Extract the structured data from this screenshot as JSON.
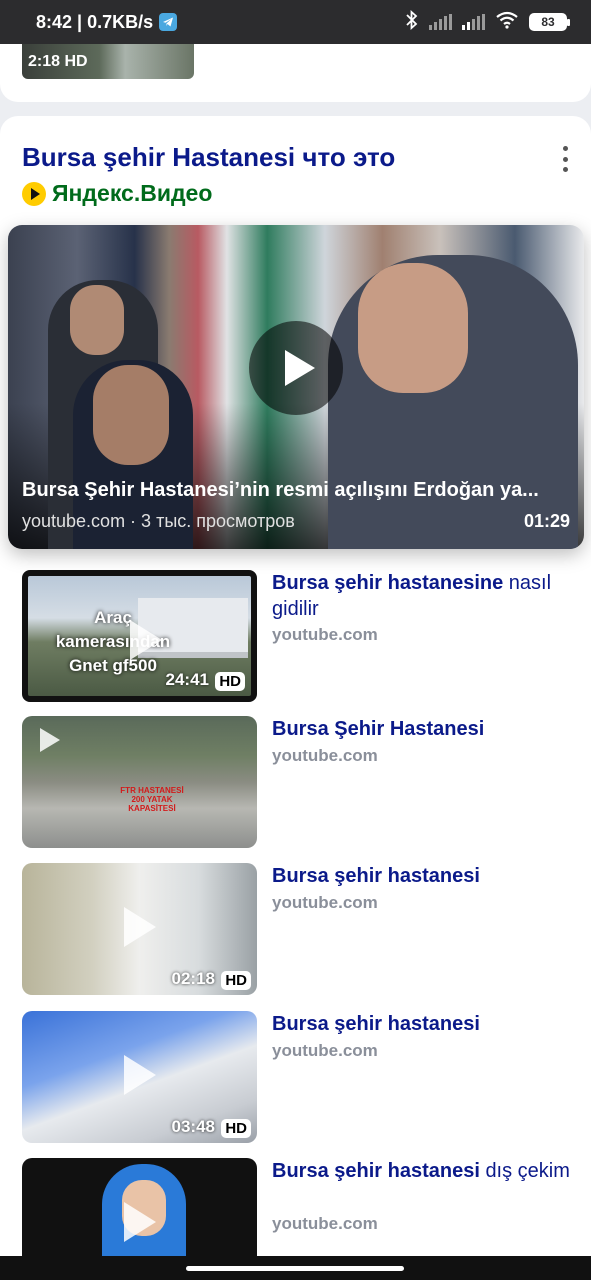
{
  "status_bar": {
    "time_speed": "8:42 | 0.7KB/s",
    "battery": "83"
  },
  "prev_card": {
    "badge": "2:18 HD"
  },
  "card": {
    "title": "Bursa şehir Hastanesi что это",
    "source": "Яндекс.Видео"
  },
  "hero": {
    "title": "Bursa Şehir Hastanesi’nin resmi açılışını Erdoğan ya...",
    "meta": "youtube.com · 3 тыс. просмотров",
    "duration": "01:29"
  },
  "videos": [
    {
      "title_bold": "Bursa şehir hastanesine",
      "title_rest": "nasıl gidilir",
      "source": "youtube.com",
      "duration": "24:41",
      "hd": "HD",
      "overlay_text": "Araç kamerasından Gnet gf500"
    },
    {
      "title_bold": "Bursa Şehir Hastanesi",
      "title_rest": "",
      "source": "youtube.com",
      "duration": "",
      "hd": "",
      "overlay_text": "FTR HASTANESİ 200 YATAK KAPASİTESİ"
    },
    {
      "title_bold": "Bursa şehir hastanesi",
      "title_rest": "",
      "source": "youtube.com",
      "duration": "02:18",
      "hd": "HD"
    },
    {
      "title_bold": "Bursa şehir hastanesi",
      "title_rest": "",
      "source": "youtube.com",
      "duration": "03:48",
      "hd": "HD"
    },
    {
      "title_bold": "Bursa şehir hastanesi",
      "title_rest": "dış çekim",
      "source": "youtube.com",
      "duration": "",
      "hd": ""
    }
  ],
  "icons": {
    "telegram": "telegram-icon",
    "bluetooth": "bluetooth-icon",
    "wifi": "wifi-icon",
    "yandex": "yandex-video-icon",
    "more": "more-vertical-icon"
  }
}
